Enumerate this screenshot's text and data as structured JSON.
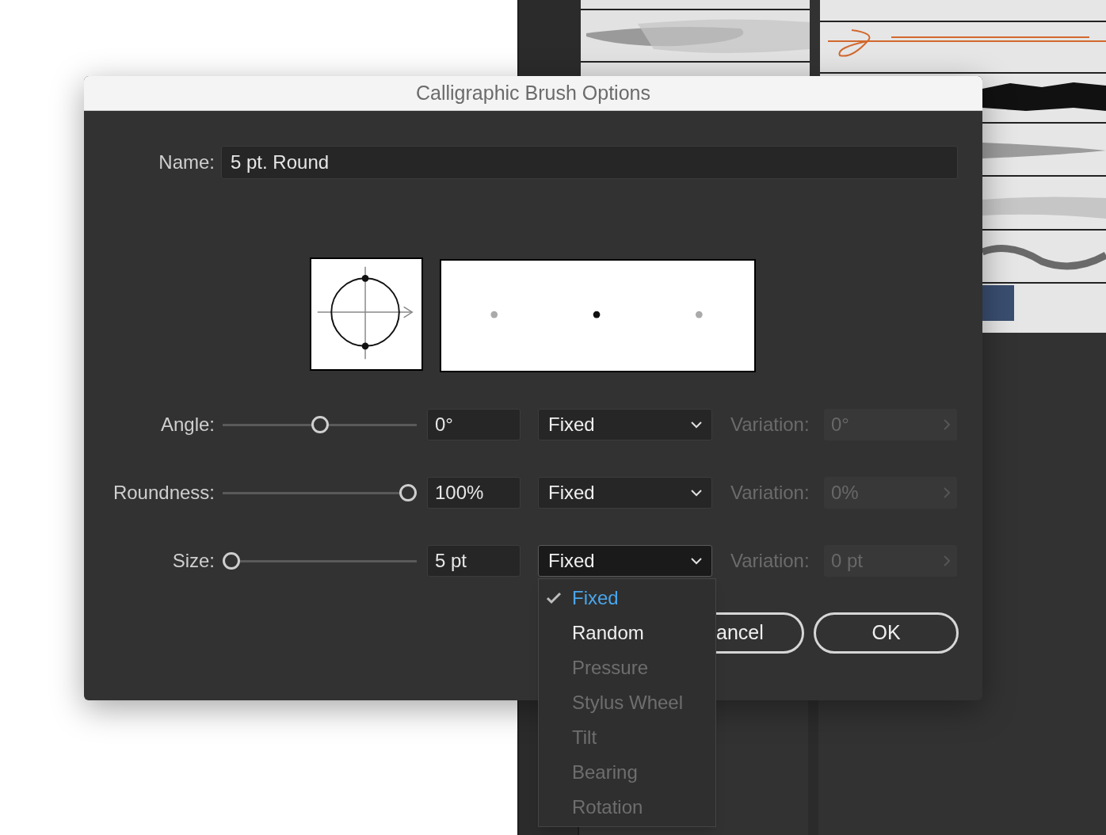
{
  "dialog": {
    "title": "Calligraphic Brush Options",
    "name_field": {
      "label": "Name:",
      "value": "5 pt. Round"
    },
    "options": [
      {
        "label": "Angle:",
        "level": 0.5,
        "value": "0°",
        "method": "Fixed",
        "expanded": false,
        "variation_label": "Variation:",
        "variation": "0°",
        "variation_disabled": true
      },
      {
        "label": "Roundness:",
        "level": 1,
        "value": "100%",
        "method": "Fixed",
        "expanded": false,
        "variation_label": "Variation:",
        "variation": "0%",
        "variation_disabled": true
      },
      {
        "label": "Size:",
        "level": 0,
        "value": "5 pt",
        "method": "Fixed",
        "expanded": true,
        "variation_label": "Variation:",
        "variation": "0 pt",
        "variation_disabled": true
      }
    ],
    "menu_items": [
      {
        "label": "Fixed",
        "selected": true,
        "disabled": false
      },
      {
        "label": "Random",
        "selected": false,
        "disabled": false
      },
      {
        "label": "Pressure",
        "selected": false,
        "disabled": true
      },
      {
        "label": "Stylus Wheel",
        "selected": false,
        "disabled": true
      },
      {
        "label": "Tilt",
        "selected": false,
        "disabled": true
      },
      {
        "label": "Bearing",
        "selected": false,
        "disabled": true
      },
      {
        "label": "Rotation",
        "selected": false,
        "disabled": true
      }
    ],
    "buttons": [
      {
        "label": "ancel",
        "kind": "cancel"
      },
      {
        "label": "OK",
        "kind": "default"
      }
    ]
  }
}
